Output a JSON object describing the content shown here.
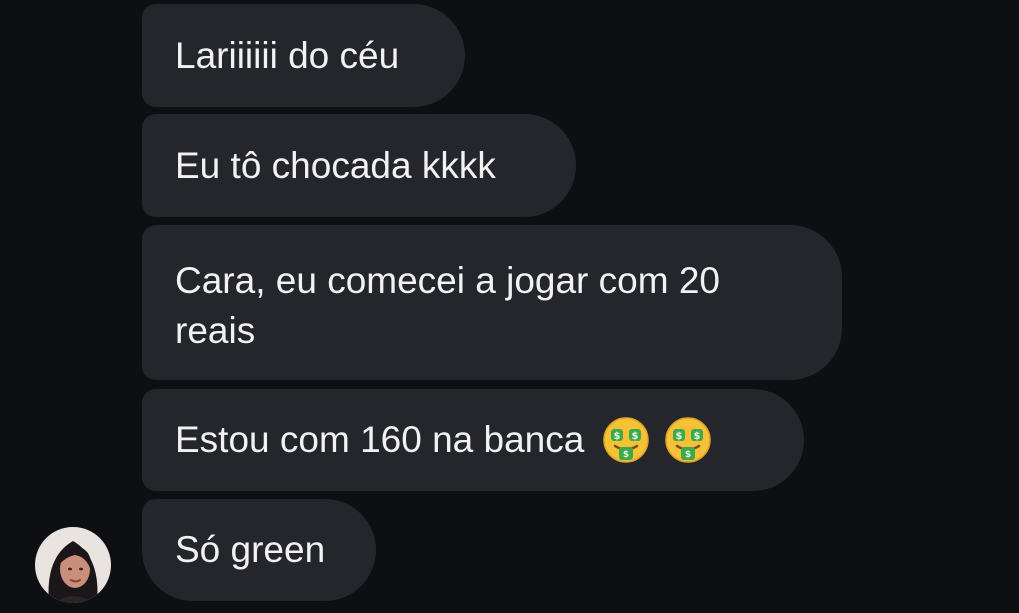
{
  "messages": [
    {
      "text": "Lariiiiii do céu"
    },
    {
      "text": "Eu tô chocada kkkk"
    },
    {
      "text": "Cara, eu comecei a jogar com 20 reais"
    },
    {
      "text": "Estou com 160 na banca",
      "emojis": [
        "money-mouth-face-icon",
        "money-mouth-face-icon"
      ]
    },
    {
      "text": "Só green"
    }
  ],
  "colors": {
    "background": "#0e0f12",
    "bubble": "#25262b",
    "text": "#f2f2f2",
    "emoji_face": "#f5c136",
    "emoji_money": "#3fa84a"
  }
}
